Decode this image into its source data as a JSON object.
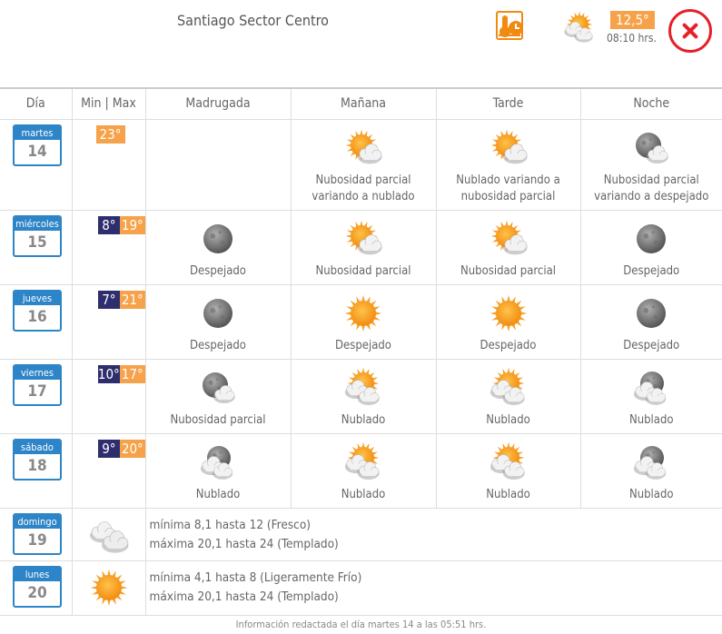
{
  "header": {
    "title": "Santiago Sector Centro",
    "current_temp": "12,5°",
    "time": "08:10 hrs."
  },
  "columns": [
    "Día",
    "Min | Max",
    "Madrugada",
    "Mañana",
    "Tarde",
    "Noche"
  ],
  "days": [
    {
      "day": "martes",
      "date": "14",
      "min": "",
      "max": "23°",
      "cells": [
        {
          "icon": "none",
          "text": ""
        },
        {
          "icon": "sun-cloud",
          "text": "Nubosidad parcial variando a nublado"
        },
        {
          "icon": "sun-cloud",
          "text": "Nublado variando a nubosidad parcial"
        },
        {
          "icon": "moon-cloud",
          "text": "Nubosidad parcial variando a despejado"
        }
      ]
    },
    {
      "day": "miércoles",
      "date": "15",
      "min": "8°",
      "max": "19°",
      "cells": [
        {
          "icon": "moon",
          "text": "Despejado"
        },
        {
          "icon": "sun-cloud",
          "text": "Nubosidad parcial"
        },
        {
          "icon": "sun-cloud",
          "text": "Nubosidad parcial"
        },
        {
          "icon": "moon",
          "text": "Despejado"
        }
      ]
    },
    {
      "day": "jueves",
      "date": "16",
      "min": "7°",
      "max": "21°",
      "cells": [
        {
          "icon": "moon",
          "text": "Despejado"
        },
        {
          "icon": "sun",
          "text": "Despejado"
        },
        {
          "icon": "sun",
          "text": "Despejado"
        },
        {
          "icon": "moon",
          "text": "Despejado"
        }
      ]
    },
    {
      "day": "viernes",
      "date": "17",
      "min": "10°",
      "max": "17°",
      "cells": [
        {
          "icon": "moon-cloud",
          "text": "Nubosidad parcial"
        },
        {
          "icon": "sun-clouds",
          "text": "Nublado"
        },
        {
          "icon": "sun-clouds",
          "text": "Nublado"
        },
        {
          "icon": "moon-clouds",
          "text": "Nublado"
        }
      ]
    },
    {
      "day": "sábado",
      "date": "18",
      "min": "9°",
      "max": "20°",
      "cells": [
        {
          "icon": "moon-clouds",
          "text": "Nublado"
        },
        {
          "icon": "sun-clouds",
          "text": "Nublado"
        },
        {
          "icon": "sun-clouds",
          "text": "Nublado"
        },
        {
          "icon": "moon-clouds",
          "text": "Nublado"
        }
      ]
    }
  ],
  "extended": [
    {
      "day": "domingo",
      "date": "19",
      "icon": "clouds",
      "min_text": "mínima 8,1 hasta 12 (Fresco)",
      "max_text": "máxima 20,1 hasta 24 (Templado)"
    },
    {
      "day": "lunes",
      "date": "20",
      "icon": "sun",
      "min_text": "mínima 4,1 hasta 8 (Ligeramente Frío)",
      "max_text": "máxima 20,1 hasta 24 (Templado)"
    }
  ],
  "footer": "Información redactada el día martes 14 a las 05:51 hrs.",
  "colors": {
    "accent_orange": "#f6a24a",
    "min_navy": "#2e2d6e",
    "date_blue": "#2d84c7",
    "close_red": "#e5202a"
  }
}
